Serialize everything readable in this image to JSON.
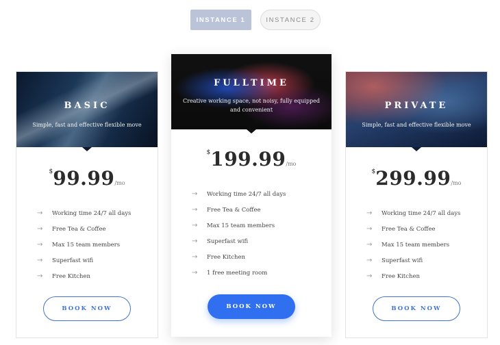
{
  "tabs": [
    {
      "label": "INSTANCE 1",
      "active": true
    },
    {
      "label": "INSTANCE 2",
      "active": false
    }
  ],
  "cards": [
    {
      "name": "BASIC",
      "description": "Simple, fast and effective flexible move",
      "currency": "$",
      "price": "99.99",
      "period": "/mo",
      "features": [
        "Working time 24/7 all days",
        "Free Tea & Coffee",
        "Max 15 team members",
        "Superfast wifi",
        "Free Kitchen"
      ],
      "button": "BOOK NOW"
    },
    {
      "name": "FULLTIME",
      "description": "Creative working space, not noisy, fully equipped and convenient",
      "currency": "$",
      "price": "199.99",
      "period": "/mo",
      "features": [
        "Working time 24/7 all days",
        "Free Tea & Coffee",
        "Max 15 team members",
        "Superfast wifi",
        "Free Kitchen",
        "1 free meeting room"
      ],
      "button": "BOOK NOW"
    },
    {
      "name": "PRIVATE",
      "description": "Simple, fast and effective flexible move",
      "currency": "$",
      "price": "299.99",
      "period": "/mo",
      "features": [
        "Working time 24/7 all days",
        "Free Tea & Coffee",
        "Max 15 team members",
        "Superfast wifi",
        "Free Kitchen"
      ],
      "button": "BOOK NOW"
    }
  ],
  "icons": {
    "feature_bullet": "arrow-right-icon",
    "arrow_glyph": "→"
  },
  "colors": {
    "accent": "#2f6ff0",
    "tab_active": "#bac3d8",
    "outline": "#3f74d4"
  }
}
